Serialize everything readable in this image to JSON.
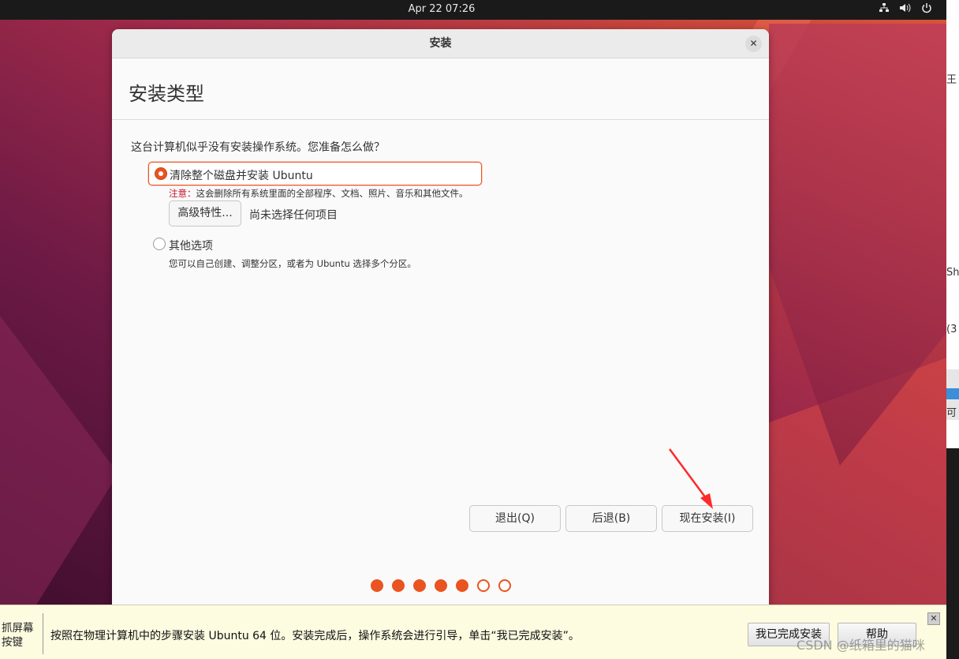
{
  "topbar": {
    "clock": "Apr 22  07:26",
    "tray_icons": [
      "network-icon",
      "volume-icon",
      "power-icon"
    ]
  },
  "window": {
    "title": "安装",
    "page_title": "安装类型",
    "question": "这台计算机似乎没有安装操作系统。您准备怎么做？",
    "option_erase": {
      "label": "清除整个磁盘并安装 Ubuntu",
      "selected": true,
      "note_prefix": "注意：",
      "note_text": "这会删除所有系统里面的全部程序、文档、照片、音乐和其他文件。",
      "advanced_button": "高级特性...",
      "advanced_status": "尚未选择任何项目"
    },
    "option_other": {
      "label": "其他选项",
      "selected": false,
      "description": "您可以自己创建、调整分区，或者为 Ubuntu 选择多个分区。"
    },
    "buttons": {
      "quit": "退出(Q)",
      "back": "后退(B)",
      "install_now": "现在安装(I)"
    },
    "progress": {
      "completed_steps": 5,
      "total_steps": 7
    }
  },
  "hint_bar": {
    "left_label": "抓屏幕按键",
    "message": "按照在物理计算机中的步骤安装 Ubuntu 64 位。安装完成后，操作系统会进行引导，单击“我已完成安装”。",
    "done_button": "我已完成安装",
    "help_button": "帮助"
  },
  "watermark": "CSDN @纸箱里的猫咪",
  "right_strip": {
    "texts": [
      "王",
      "Sh",
      "(3",
      "可"
    ]
  },
  "colors": {
    "accent": "#e95420",
    "warning": "#c7162b",
    "annotation_arrow": "#ff2a2a"
  }
}
